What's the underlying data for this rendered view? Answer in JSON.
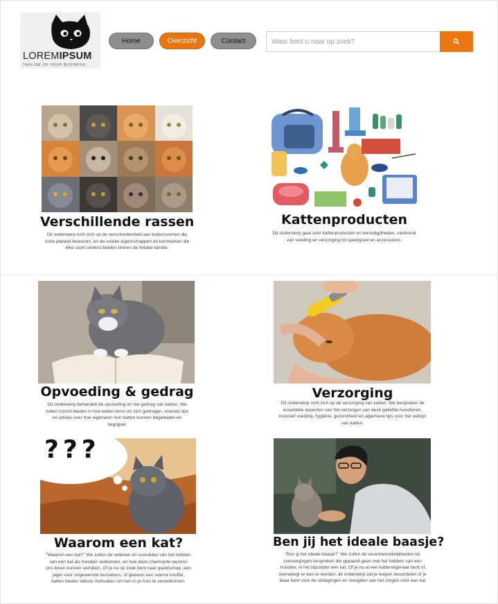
{
  "logo": {
    "main_left": "LOREM",
    "main_right": "IPSUM",
    "tagline": "TAGLINE OF YOUR BUSINESS"
  },
  "nav": {
    "home": "Home",
    "overview": "Overzicht",
    "contact": "Contact"
  },
  "search": {
    "placeholder": "Waar bent u naar op zoek?",
    "value": ""
  },
  "colors": {
    "accent": "#e8760f",
    "nav_gray": "#8e8e8e"
  },
  "cards": [
    {
      "title": "Verschillende rassen",
      "text": "Dit onderwerp richt zich op de verscheidenheid aan kattensoorten die onze planeet bewonen, en de unieke eigenschappen en kenmerken die elke soort onderscheiden binnen de felidae-familie."
    },
    {
      "title": "Kattenproducten",
      "text": "Dit onderwerp gaat over kattenproducten en benodigdheden, variërend van voeding en verzorging tot speelgoed en accessoires."
    },
    {
      "title": "Opvoeding & gedrag",
      "text": "Dit onderwerp behandelt de opvoeding en het gedrag van katten. We zullen inzicht bieden in hoe katten leren en zich gedragen, evenals tips en advies over hoe eigenaren hun katten kunnen begeleiden en begrijpen"
    },
    {
      "title": "Verzorging",
      "text": "Dit onderwerp richt zich op de verzorging van katten. We bespreken de essentiële aspecten van het verzorgen van deze geliefde huisdieren, inclusief voeding, hygiëne, gezondheid en algemene tips voor het welzijn van katten."
    },
    {
      "title": "Waarom een kat?",
      "text": "\"Waarom een kat?\" We zullen de redenen en voordelen van het hebben van een kat als huisdier verkennen, en hoe deze charmante wezens ons leven kunnen verrijken. Of je nu op zoek bent naar gezelschap, een jager voor ongewenste bezoekers, of gewoon een warme knuffel, katten bieden talloze motivaties om hen in je huis te verwelkomen."
    },
    {
      "title": "Ben jij het ideale baasje?",
      "text": "\"Ben jij het ideale baasje?\" We zullen de verantwoordelijkheden en overwegingen bespreken die gepaard gaan met het hebben van een huisdier, in het bijzonder een kat. Of je nu al een katteneigenaar bent of overweegt er een te worden, dit onderwerp zal je helpen beoordelen of je klaar bent voor de uitdagingen en vreugden van het zorgen voor een kat"
    }
  ],
  "thought_bubble": "???",
  "icons": {
    "search_button": "search-icon",
    "logo_cat": "cat-logo-icon"
  }
}
